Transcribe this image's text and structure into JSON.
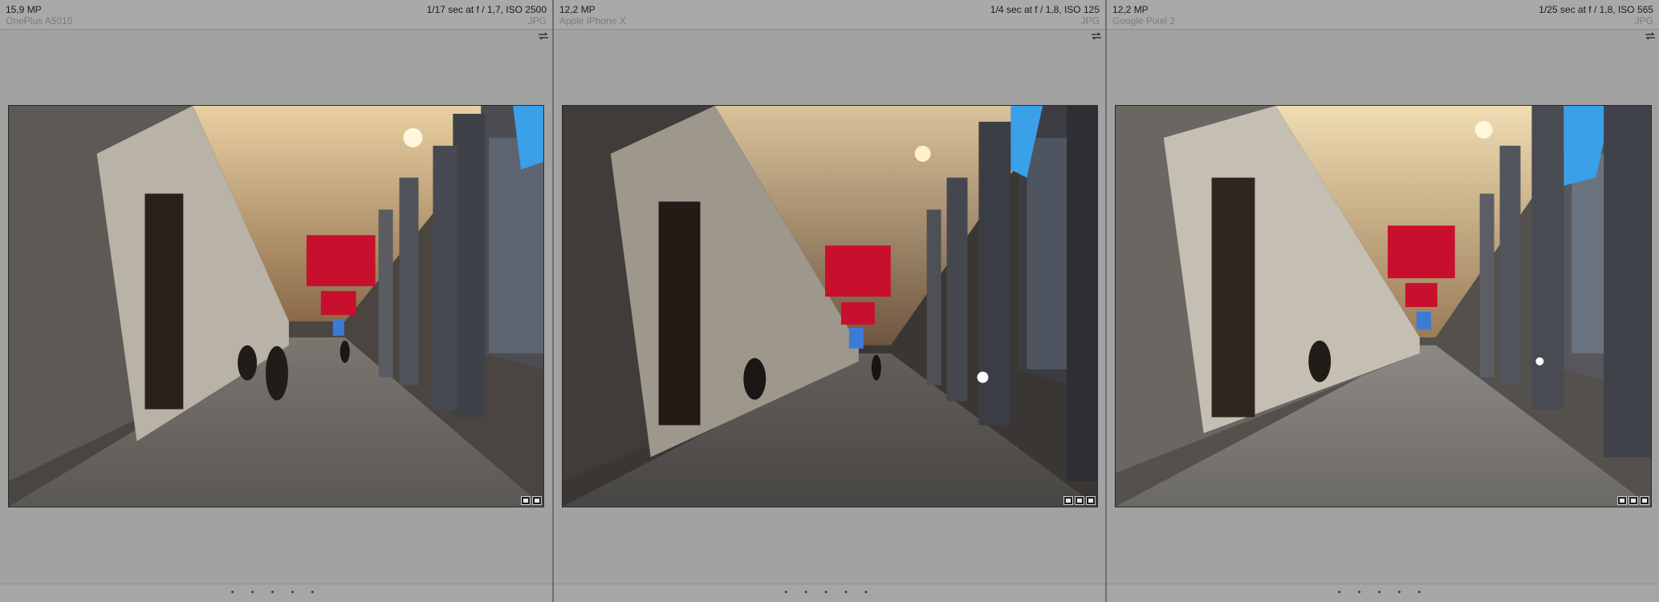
{
  "cells": [
    {
      "megapixels": "15,9 MP",
      "camera": "OnePlus A5010",
      "exposure": "1/17 sec at f / 1,7, ISO 2500",
      "filetype": "JPG",
      "rating": "• • • • •"
    },
    {
      "megapixels": "12,2 MP",
      "camera": "Apple iPhone X",
      "exposure": "1/4 sec at f / 1,8, ISO 125",
      "filetype": "JPG",
      "rating": "• • • • •"
    },
    {
      "megapixels": "12,2 MP",
      "camera": "Google Pixel 2",
      "exposure": "1/25 sec at f / 1,8, ISO 565",
      "filetype": "JPG",
      "rating": "• • • • •"
    }
  ],
  "colors": {
    "panel_bg": "#a2a2a2",
    "banner_red": "#c8102e",
    "sky_blue": "#3aa0e8"
  }
}
